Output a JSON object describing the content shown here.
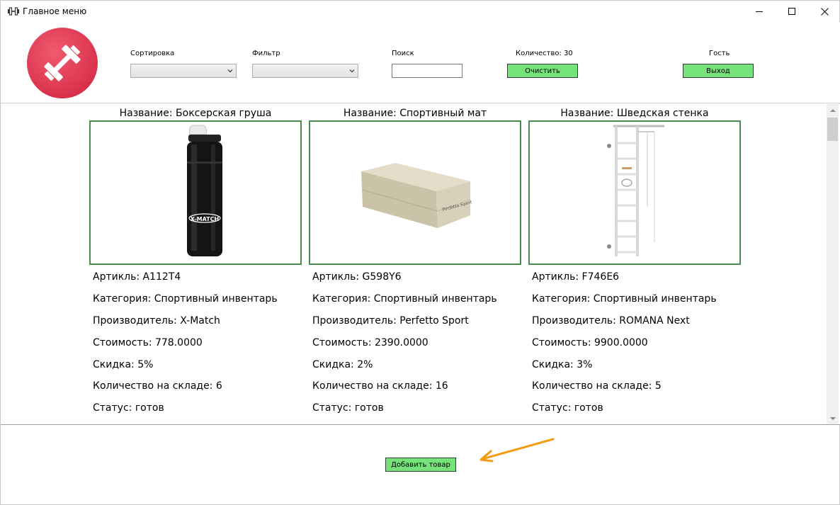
{
  "window": {
    "title": "Главное меню",
    "icon": "dumbbell-icon"
  },
  "header": {
    "sort_label": "Сортировка",
    "sort_value": "",
    "filter_label": "Фильтр",
    "filter_value": "",
    "search_label": "Поиск",
    "search_value": "",
    "count_label": "Количество: 30",
    "clear_button": "Очистить",
    "user_label": "Гость",
    "exit_button": "Выход"
  },
  "products": [
    {
      "title": "Название: Боксерская груша",
      "image": "punching-bag-image",
      "image_text": "X-MATCH",
      "article": "Артикль: A112T4",
      "category": "Категория: Спортивный инвентарь",
      "manufacturer": "Производитель: X-Match",
      "price": "Стоимость: 778.0000",
      "discount": "Скидка: 5%",
      "stock": "Количество на складе: 6",
      "status": "Статус: готов"
    },
    {
      "title": "Название: Спортивный мат",
      "image": "gym-mat-image",
      "image_text": "Perfetto Sport",
      "article": "Артикль: G598Y6",
      "category": "Категория: Спортивный инвентарь",
      "manufacturer": "Производитель: Perfetto Sport",
      "price": "Стоимость: 2390.0000",
      "discount": "Скидка: 2%",
      "stock": "Количество на складе: 16",
      "status": "Статус: готов"
    },
    {
      "title": "Название: Шведская стенка",
      "image": "wall-bars-image",
      "article": "Артикль: F746E6",
      "category": "Категория: Спортивный инвентарь",
      "manufacturer": "Производитель: ROMANA Next",
      "price": "Стоимость: 9900.0000",
      "discount": "Скидка: 3%",
      "stock": "Количество на складе: 5",
      "status": "Статус: готов"
    }
  ],
  "footer": {
    "add_button": "Добавить товар"
  },
  "colors": {
    "button_green": "#76e27a",
    "card_border": "#4a8a4f",
    "logo_red": "#e0354f",
    "annotation_arrow": "#f39c12"
  }
}
